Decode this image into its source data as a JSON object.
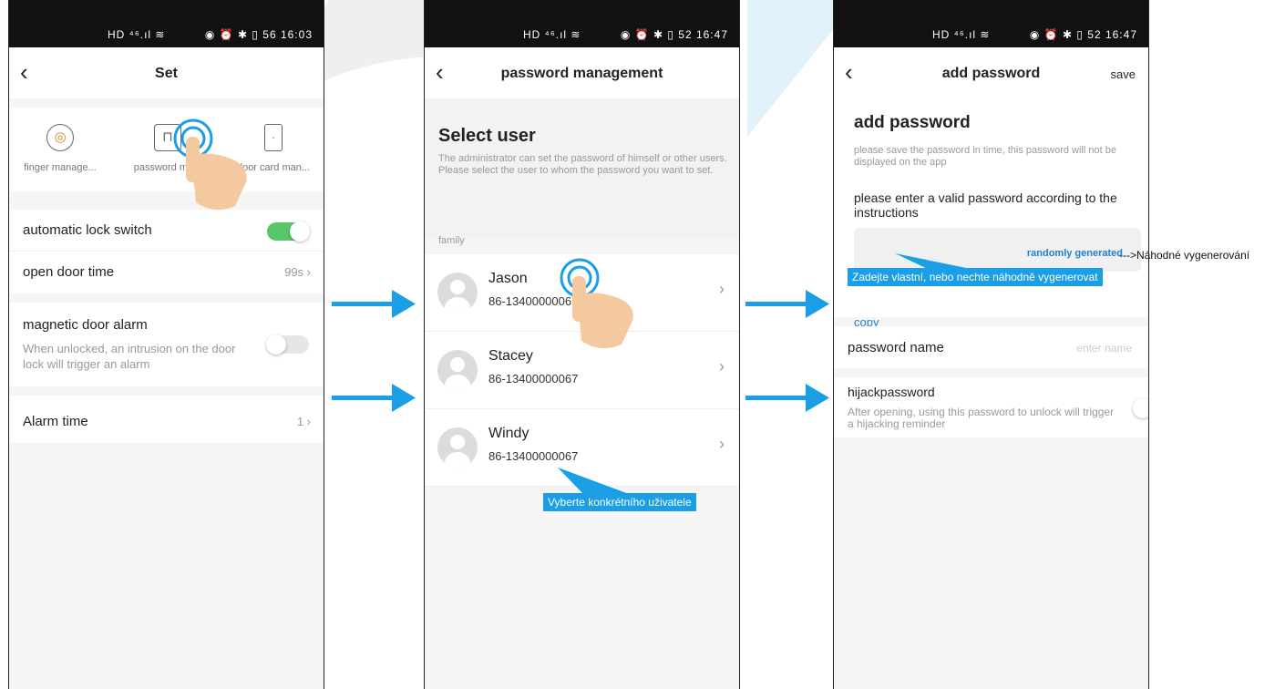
{
  "colors": {
    "accent": "#1a9ee6",
    "toggle_on": "#57c66a",
    "link": "#1e7fd0"
  },
  "status_bar": {
    "panel1": {
      "signal": "HD ⁴⁶.ıl ≋",
      "icons": "◉ ⏰ ✱ ▯ 56 16:03"
    },
    "panel2": {
      "signal": "HD ⁴⁶.ıl ≋",
      "icons": "◉ ⏰ ✱ ▯ 52 16:47"
    },
    "panel3": {
      "signal": "HD ⁴⁶.ıl ≋",
      "icons": "◉ ⏰ ✱ ▯ 52 16:47"
    }
  },
  "panel1": {
    "back_icon": "‹",
    "title": "Set",
    "tiles": [
      {
        "label": "finger manage...",
        "icon": "fingerprint-icon"
      },
      {
        "label": "password ma...",
        "icon": "lock-icon"
      },
      {
        "label": "door card man...",
        "icon": "door-card-icon"
      }
    ],
    "rows": {
      "auto_lock": {
        "label": "automatic lock switch",
        "toggle_on": true
      },
      "open_door": {
        "label": "open door time",
        "value": "99s ›"
      },
      "magnetic": {
        "label": "magnetic door alarm",
        "sub": "When unlocked, an intrusion on the door lock will trigger an alarm",
        "toggle_on": false
      },
      "alarm_time": {
        "label": "Alarm time",
        "value": "1 ›"
      }
    }
  },
  "panel2": {
    "back_icon": "‹",
    "title": "password management",
    "heading": "Select user",
    "description": "The administrator can set the password of himself or other users. Please select the user to whom the password you want to set.",
    "group": "family",
    "users": [
      {
        "name": "Jason",
        "phone": "86-13400000067"
      },
      {
        "name": "Stacey",
        "phone": "86-13400000067"
      },
      {
        "name": "Windy",
        "phone": "86-13400000067"
      }
    ],
    "chevron": "›",
    "callout": "Vyberte konkrétního uživatele"
  },
  "panel3": {
    "back_icon": "‹",
    "title": "add password",
    "save": "save",
    "heading": "add password",
    "notice": "please save the password in time, this password will not be displayed on the app",
    "instruction": "please enter a valid password according to the instructions",
    "random": "randomly generated",
    "copy": "copy",
    "name_label": "password name",
    "name_placeholder": "enter name",
    "hijack_label": "hijackpassword",
    "hijack_sub": "After opening, using this password to unlock will trigger a hijacking reminder",
    "callout": "Zadejte vlastní, nebo nechte náhodně vygenerovat",
    "external_label": "--->Náhodné vygenerování"
  }
}
